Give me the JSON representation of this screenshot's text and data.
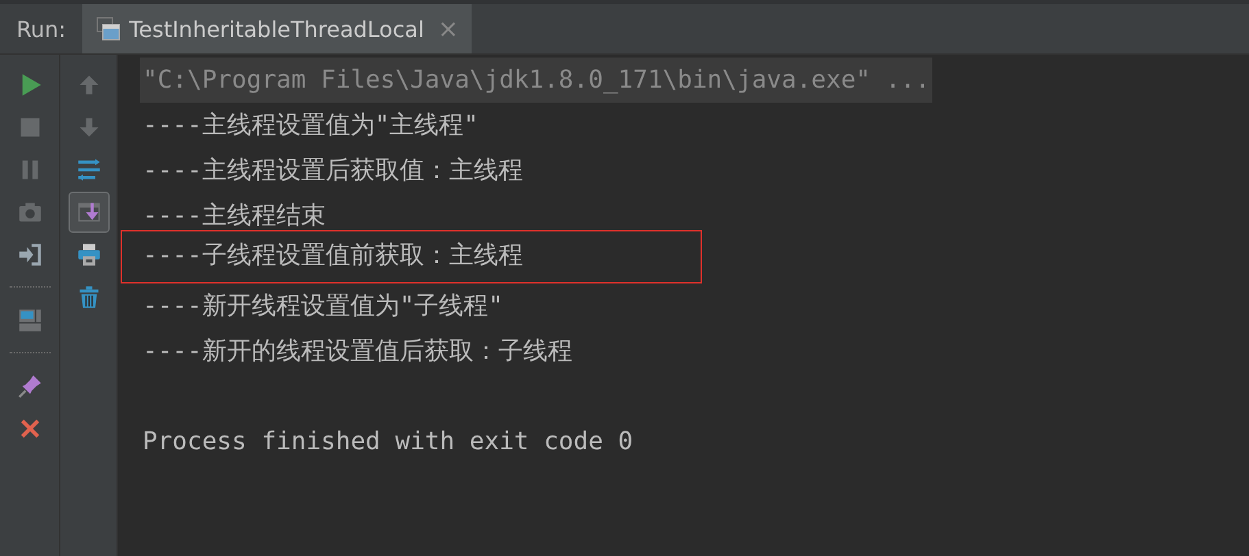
{
  "run_label": "Run:",
  "tab": {
    "title": "TestInheritableThreadLocal",
    "close": "×"
  },
  "toolbar_left": [
    {
      "kind": "run",
      "disabled": false
    },
    {
      "kind": "stop",
      "disabled": true
    },
    {
      "kind": "pause",
      "disabled": true
    },
    {
      "kind": "camera",
      "disabled": true
    },
    {
      "kind": "login",
      "disabled": false
    },
    {
      "kind": "separator"
    },
    {
      "kind": "layout",
      "disabled": false
    },
    {
      "kind": "separator"
    },
    {
      "kind": "pin",
      "disabled": false
    },
    {
      "kind": "close",
      "disabled": false
    }
  ],
  "toolbar_right": [
    {
      "kind": "up",
      "disabled": true,
      "selected": false
    },
    {
      "kind": "down",
      "disabled": true,
      "selected": false
    },
    {
      "kind": "wrap",
      "disabled": false,
      "selected": false
    },
    {
      "kind": "scroll-end",
      "disabled": false,
      "selected": true
    },
    {
      "kind": "print",
      "disabled": false,
      "selected": false
    },
    {
      "kind": "trash",
      "disabled": false,
      "selected": false
    }
  ],
  "console": [
    {
      "text": "\"C:\\Program Files\\Java\\jdk1.8.0_171\\bin\\java.exe\" ...",
      "kind": "command",
      "boxed": false
    },
    {
      "text": "----主线程设置值为\"主线程\"",
      "kind": "output",
      "boxed": false
    },
    {
      "text": "----主线程设置后获取值：主线程",
      "kind": "output",
      "boxed": false
    },
    {
      "text": "----主线程结束",
      "kind": "output",
      "boxed": false
    },
    {
      "text": "----子线程设置值前获取：主线程",
      "kind": "output",
      "boxed": true
    },
    {
      "text": "----新开线程设置值为\"子线程\"",
      "kind": "output",
      "boxed": false
    },
    {
      "text": "----新开的线程设置值后获取：子线程",
      "kind": "output",
      "boxed": false
    },
    {
      "text": "Process finished with exit code 0",
      "kind": "exit",
      "boxed": false
    }
  ]
}
